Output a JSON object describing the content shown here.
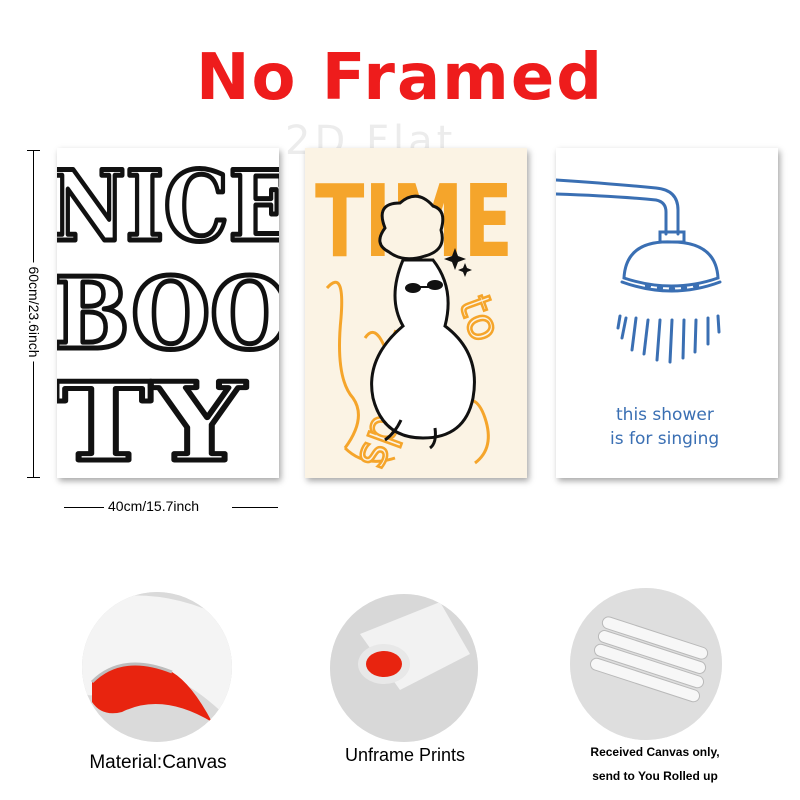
{
  "header": {
    "title": "No Framed",
    "watermark": "2D Flat"
  },
  "posters": {
    "nice_booty": {
      "lines": [
        "NICE",
        "BOO",
        "TY"
      ]
    },
    "time_to_sparkle": {
      "headline": "TIME",
      "words": [
        "to",
        "sparkle"
      ]
    },
    "shower": {
      "line1": "this shower",
      "line2": "is for singing"
    }
  },
  "dimensions": {
    "height_label": "60cm/23.6inch",
    "width_label": "40cm/15.7inch"
  },
  "features": [
    {
      "caption": "Material:Canvas"
    },
    {
      "caption": "Unframe  Prints"
    },
    {
      "caption_line1": "Received Canvas only,",
      "caption_line2": "send to You Rolled up"
    }
  ],
  "colors": {
    "title": "#ee1c1c",
    "sparkle_orange": "#f5a52b",
    "shower_blue": "#3a6fb3",
    "canvas_red": "#e8240f"
  }
}
